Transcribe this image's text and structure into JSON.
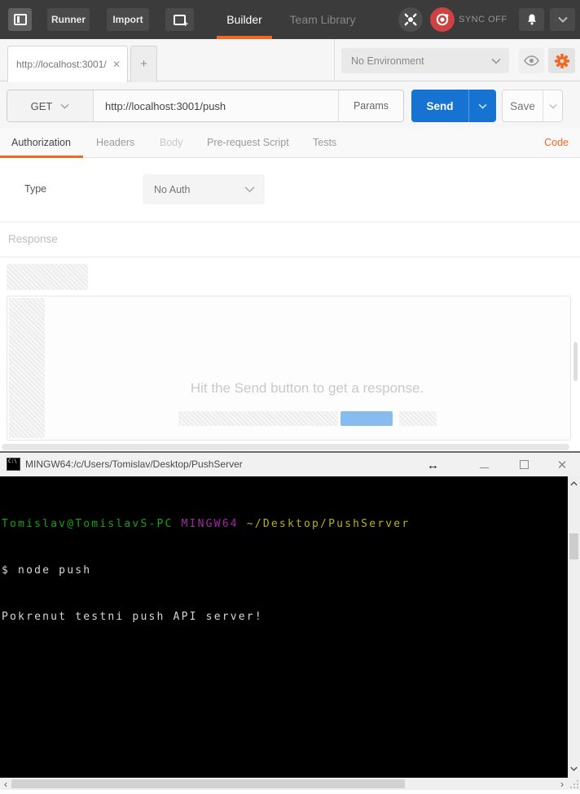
{
  "topbar": {
    "runner_label": "Runner",
    "import_label": "Import",
    "nav": {
      "builder": "Builder",
      "team_library": "Team Library"
    },
    "sync_label": "SYNC OFF"
  },
  "env_row": {
    "request_tab_label": "http://localhost:3001/",
    "environment_value": "No Environment"
  },
  "request_bar": {
    "method": "GET",
    "url": "http://localhost:3001/push",
    "params_label": "Params",
    "send_label": "Send",
    "save_label": "Save"
  },
  "request_tabs": {
    "items": [
      "Authorization",
      "Headers",
      "Body",
      "Pre-request Script",
      "Tests"
    ],
    "code_label": "Code"
  },
  "auth": {
    "type_label": "Type",
    "type_value": "No Auth"
  },
  "response": {
    "title": "Response",
    "empty_message": "Hit the Send button to get a response."
  },
  "terminal": {
    "title": "MINGW64:/c/Users/Tomislav/Desktop/PushServer",
    "prompt_user": "Tomislav@TomislavS-PC ",
    "prompt_env": "MINGW64 ",
    "prompt_path": "~/Desktop/PushServer",
    "command_line": "$ node push",
    "output_line": "Pokrenut testni push API server!"
  },
  "icons": {
    "plus": "+",
    "close": "✕",
    "resize_horizontal": "↔",
    "scroll_left": "‹",
    "scroll_right": "›",
    "console_label": "C:\\"
  },
  "colors": {
    "accent_orange": "#f26722",
    "send_blue": "#1673d2",
    "skeleton_blue": "#87bcf1",
    "terminal_green": "#12a312",
    "terminal_purple": "#a229a2",
    "terminal_yellow": "#b5b413",
    "terminal_white": "#d6d6d6",
    "sync_red": "#cd4242"
  }
}
